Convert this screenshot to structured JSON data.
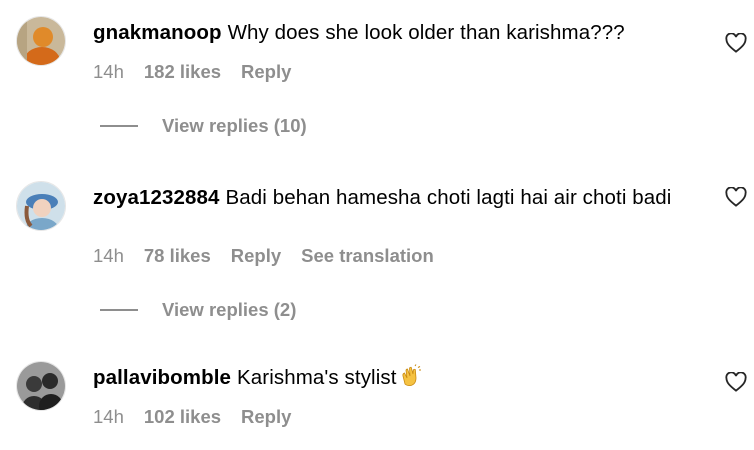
{
  "comments": [
    {
      "username": "gnakmanoop",
      "text": "Why does she look older than karishma???",
      "time": "14h",
      "likes": "182 likes",
      "reply_label": "Reply",
      "view_replies": "View replies (10)"
    },
    {
      "username": "zoya1232884",
      "text": "Badi behan hamesha choti lagti hai air choti badi",
      "time": "14h",
      "likes": "78 likes",
      "reply_label": "Reply",
      "translate_label": "See translation",
      "view_replies": "View replies (2)"
    },
    {
      "username": "pallavibomble",
      "text": "Karishma's stylist",
      "time": "14h",
      "likes": "102 likes",
      "reply_label": "Reply"
    }
  ],
  "colors": {
    "text": "#000000",
    "secondary": "#8e8e8e",
    "background": "#ffffff"
  },
  "icons": {
    "like": "heart-outline-icon",
    "emoji": "clapping-hands-icon"
  }
}
